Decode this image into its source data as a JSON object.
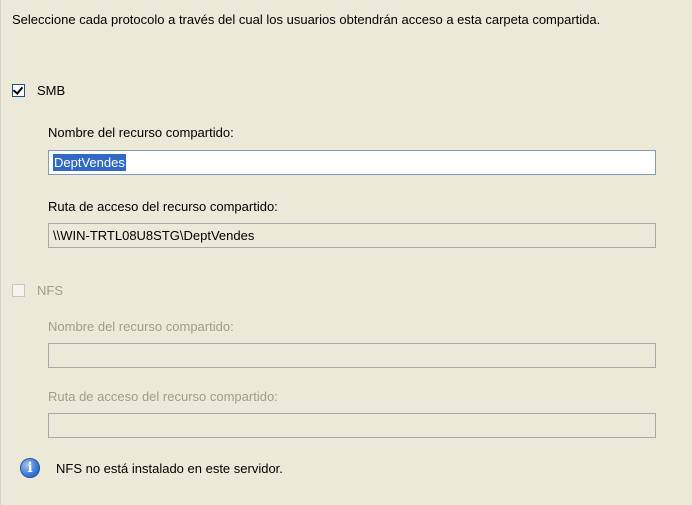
{
  "intro_text": "Seleccione cada protocolo a través del cual los usuarios obtendrán acceso a esta carpeta compartida.",
  "smb": {
    "label": "SMB",
    "checked": true,
    "share_name_label": "Nombre del recurso compartido:",
    "share_name_value": "DeptVendes",
    "share_path_label": "Ruta de acceso del recurso compartido:",
    "share_path_value": "\\\\WIN-TRTL08U8STG\\DeptVendes"
  },
  "nfs": {
    "label": "NFS",
    "checked": false,
    "share_name_label": "Nombre del recurso compartido:",
    "share_name_value": "",
    "share_path_label": "Ruta de acceso del recurso compartido:",
    "share_path_value": ""
  },
  "info": {
    "icon": "info-icon",
    "message": "NFS no está instalado en este servidor."
  },
  "colors": {
    "background": "#ece9d8",
    "selection": "#316ac5",
    "disabled_text": "#a19d8e"
  }
}
